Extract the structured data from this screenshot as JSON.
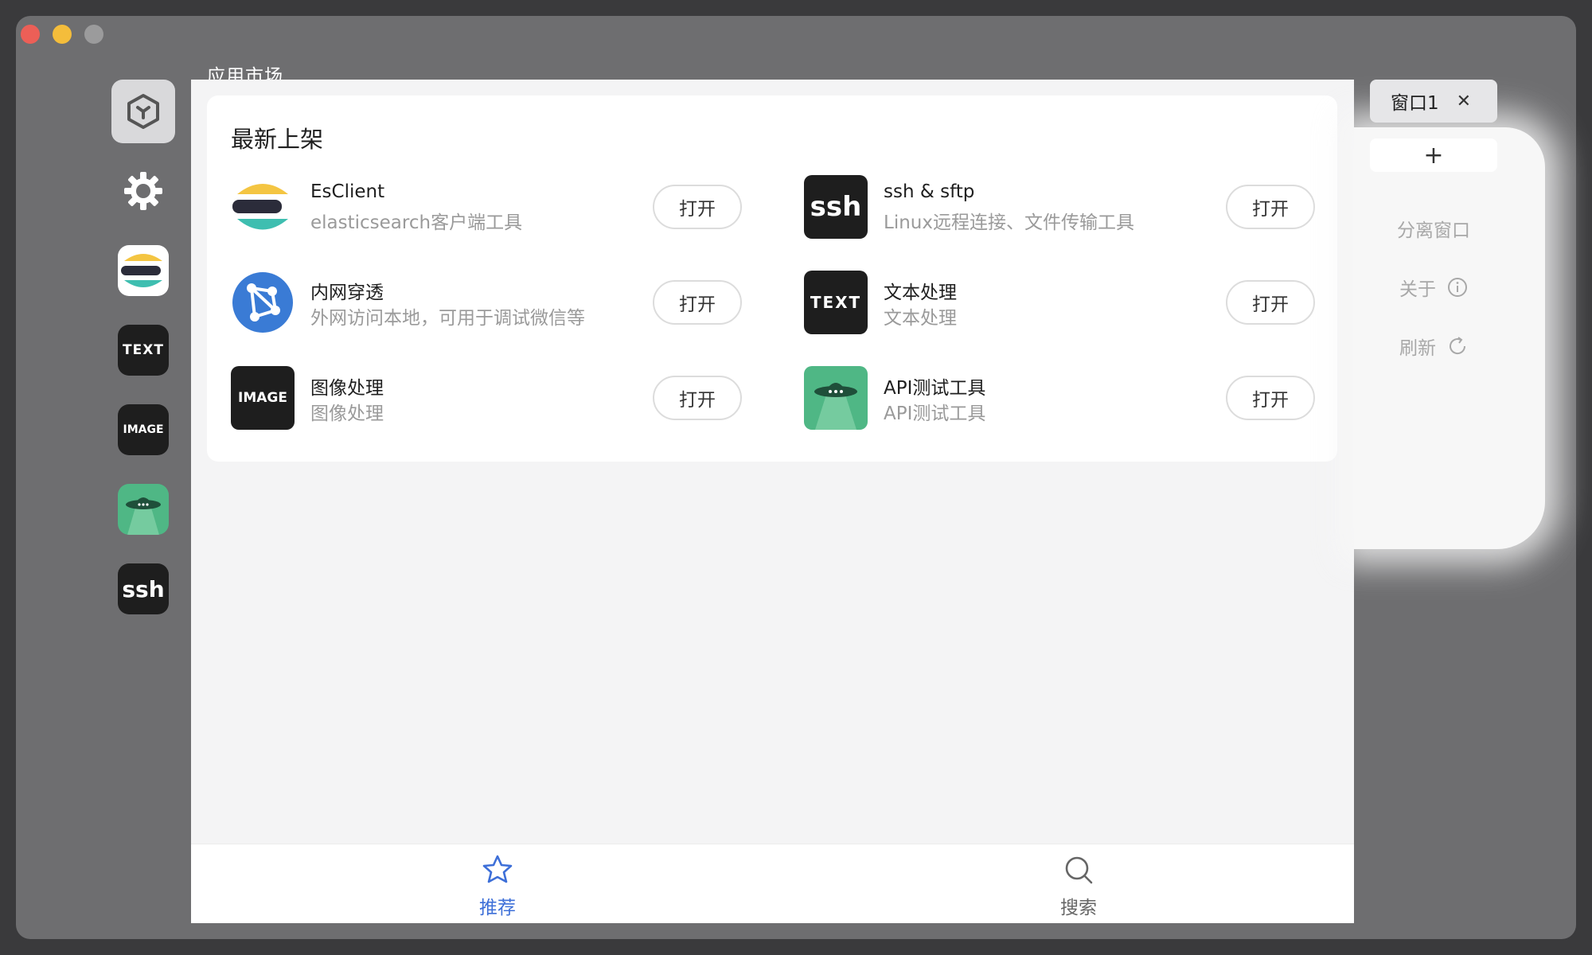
{
  "window": {
    "title": "应用市场"
  },
  "sidebar": {
    "items": [
      {
        "name": "home",
        "icon": "cube-logo-icon"
      },
      {
        "name": "settings",
        "icon": "gear-icon"
      },
      {
        "name": "esclient",
        "icon": "elastic-logo-icon"
      },
      {
        "name": "text",
        "icon": "text-logo-icon",
        "label": "TEXT"
      },
      {
        "name": "image",
        "icon": "image-logo-icon",
        "label": "IMAGE"
      },
      {
        "name": "api",
        "icon": "ufo-icon"
      },
      {
        "name": "ssh",
        "icon": "ssh-logo-icon",
        "label": "ssh"
      }
    ]
  },
  "card": {
    "title": "最新上架",
    "open_label": "打开",
    "apps": [
      {
        "name": "EsClient",
        "desc": "elasticsearch客户端工具"
      },
      {
        "name": "ssh & sftp",
        "desc": "Linux远程连接、文件传输工具"
      },
      {
        "name": "内网穿透",
        "desc": "外网访问本地，可用于调试微信等"
      },
      {
        "name": "文本处理",
        "desc": "文本处理"
      },
      {
        "name": "图像处理",
        "desc": "图像处理"
      },
      {
        "name": "API测试工具",
        "desc": "API测试工具"
      }
    ]
  },
  "tabbar": {
    "recommend": "推荐",
    "search": "搜索"
  },
  "right_panel": {
    "tab_label": "窗口1",
    "add": "+",
    "detach": "分离窗口",
    "about": "关于",
    "refresh": "刷新"
  },
  "colors": {
    "accent": "#3d6fd8",
    "elastic_yellow": "#f4c542",
    "elastic_teal": "#3ebeb0",
    "api_green": "#4fb785"
  }
}
